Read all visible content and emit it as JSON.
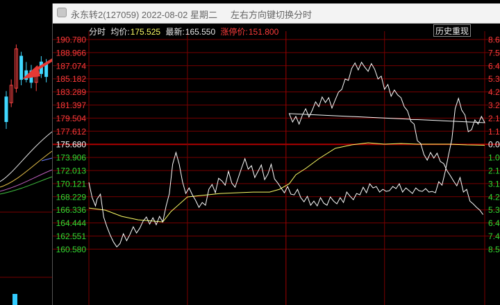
{
  "window": {
    "title": "永东转2(127059) 2022-08-02 星期二",
    "hint": "左右方向键切换分时"
  },
  "infobar": {
    "mode_label": "分时",
    "avg_label": "均价:",
    "avg_value": "175.525",
    "latest_label": "最新:",
    "latest_value": "165.550",
    "limit_label": "涨停价:",
    "limit_value": "151.800"
  },
  "history_button": "历史重现",
  "colors": {
    "up": "#ff3b3b",
    "down": "#33dd33",
    "flat": "#ffffff",
    "grid": "#7a0000",
    "price_line": "#ffffff",
    "avg_line": "#ffff66"
  },
  "chart_data": {
    "type": "line",
    "title": "",
    "reference_price": 175.68,
    "ylim": [
      160.58,
      190.78
    ],
    "y_ticks": [
      "190.780",
      "188.966",
      "187.074",
      "185.182",
      "183.289",
      "181.397",
      "179.504",
      "177.612",
      "175.680",
      "173.906",
      "172.013",
      "170.121",
      "168.229",
      "166.336",
      "164.444",
      "162.551",
      "160.580"
    ],
    "pct_ticks": [
      "8.6",
      "7.5",
      "6.4",
      "5.3",
      "4.2",
      "3.2",
      "2.1",
      "1.1",
      "0.0",
      "1.0",
      "2.1",
      "3.1",
      "4.2",
      "5.3",
      "6.4",
      "7.4",
      "8.5"
    ],
    "series": [
      {
        "role": "price",
        "x": [
          0,
          2,
          4,
          5,
          7,
          9,
          11,
          13,
          15,
          17,
          19,
          21,
          23,
          25,
          27,
          29,
          31,
          33,
          35,
          37,
          39,
          41,
          43,
          45,
          47,
          49,
          51,
          53,
          55,
          57,
          59,
          61,
          63,
          65,
          67,
          69,
          71,
          73,
          75,
          77,
          79,
          81,
          83,
          85,
          87,
          89,
          91,
          93,
          95,
          97,
          99,
          101,
          103,
          105,
          107,
          109,
          111,
          113,
          115,
          117,
          119,
          121,
          123,
          125,
          127,
          129,
          131,
          133,
          135,
          137,
          139,
          141,
          143,
          145,
          147,
          149,
          151,
          153,
          155,
          157,
          159,
          161,
          163,
          165,
          167,
          169,
          171,
          173,
          175,
          177,
          179,
          181,
          183,
          185,
          187,
          189,
          191,
          193,
          195,
          197,
          199,
          201,
          203,
          205,
          207,
          209,
          211,
          213,
          215,
          217,
          219,
          221,
          223,
          225,
          227,
          229,
          231,
          233,
          235,
          237,
          239,
          241
        ],
        "values": [
          170.2,
          168.0,
          166.8,
          167.8,
          168.5,
          165.2,
          163.8,
          162.6,
          161.6,
          160.9,
          161.4,
          162.8,
          161.8,
          162.7,
          163.8,
          162.9,
          163.6,
          164.6,
          165.2,
          164.2,
          165.1,
          164.1,
          165.3,
          164.5,
          166.8,
          168.6,
          172.8,
          174.5,
          172.8,
          170.3,
          168.6,
          169.4,
          168.4,
          167.6,
          166.6,
          167.3,
          166.9,
          169.2,
          169.9,
          168.7,
          170.8,
          170.4,
          169.8,
          171.8,
          170.1,
          169.5,
          170.9,
          172.3,
          173.6,
          172.1,
          172.6,
          170.9,
          171.8,
          172.7,
          170.6,
          171.4,
          172.8,
          170.7,
          170.1,
          169.4,
          168.7,
          169.6,
          168.5,
          168.4,
          169.2,
          168.0,
          167.4,
          168.2,
          166.9,
          167.5,
          166.8,
          168.0,
          167.2,
          166.9,
          168.1,
          167.5,
          167.1,
          168.0,
          167.3,
          168.8,
          168.2,
          167.7,
          168.6,
          168.4,
          169.5,
          168.7,
          170.0,
          169.4,
          169.6,
          168.8,
          169.2,
          168.9,
          169.0,
          169.6,
          169.3,
          170.0,
          168.8,
          169.4,
          169.0,
          168.6,
          169.4,
          169.0,
          168.9,
          169.3,
          168.8,
          168.9,
          168.7,
          170.3,
          169.8,
          171.8,
          174.2,
          176.4,
          180.8,
          182.3,
          180.6,
          179.9,
          177.5,
          177.8,
          179.2,
          178.6,
          179.7,
          178.8
        ],
        "x2": [
          122,
          124,
          126,
          128,
          130,
          132,
          134,
          136,
          138,
          140,
          142,
          144,
          146,
          148,
          150,
          152,
          154,
          156,
          158,
          160,
          162,
          164,
          166,
          168,
          170,
          172,
          174,
          176,
          178,
          180,
          182,
          184,
          186,
          188,
          190,
          192,
          194,
          196,
          198,
          200,
          202,
          204,
          206,
          208,
          210,
          212,
          214,
          216,
          218,
          220,
          222,
          224,
          226,
          228,
          230,
          232,
          234,
          236,
          238,
          240
        ],
        "values2": [
          180.1,
          178.9,
          179.7,
          178.6,
          179.9,
          180.8,
          179.6,
          180.6,
          181.8,
          181.1,
          182.5,
          181.7,
          182.4,
          180.9,
          182.1,
          183.2,
          183.6,
          185.1,
          184.9,
          186.6,
          187.4,
          186.4,
          187.5,
          186.8,
          186.2,
          187.3,
          186.5,
          185.1,
          185.5,
          183.6,
          184.3,
          182.6,
          183.5,
          182.8,
          182.4,
          181.1,
          180.5,
          179.0,
          178.6,
          176.2,
          175.8,
          174.2,
          173.4,
          174.5,
          173.7,
          174.4,
          173.2,
          172.9,
          171.9,
          171.2,
          170.4,
          169.7,
          170.9,
          168.8,
          169.2,
          167.5,
          167.1,
          166.6,
          166.2,
          165.55
        ]
      }
    ],
    "avg_line": {
      "x": [
        0,
        10,
        20,
        30,
        45,
        50,
        60,
        80,
        100,
        110,
        116,
        122,
        126,
        132,
        140,
        150,
        160,
        170,
        180,
        190,
        200,
        210,
        220,
        230,
        241
      ],
      "values": [
        166.5,
        166.2,
        165.3,
        164.8,
        164.5,
        166.0,
        168.1,
        168.6,
        168.8,
        168.8,
        169.2,
        170.0,
        171.3,
        172.2,
        173.6,
        175.1,
        175.6,
        175.9,
        175.7,
        175.8,
        175.7,
        175.7,
        175.7,
        175.6,
        175.55
      ]
    }
  },
  "background_chart": {
    "candles": [
      {
        "o": 0.45,
        "c": 0.62,
        "h": 0.66,
        "l": 0.4,
        "up": false
      },
      {
        "o": 0.58,
        "c": 0.7,
        "h": 0.74,
        "l": 0.55,
        "up": true
      },
      {
        "o": 0.68,
        "c": 0.95,
        "h": 0.98,
        "l": 0.65,
        "up": true
      },
      {
        "o": 0.9,
        "c": 0.74,
        "h": 0.93,
        "l": 0.7,
        "up": false
      },
      {
        "o": 0.74,
        "c": 0.8,
        "h": 0.86,
        "l": 0.72,
        "up": false
      },
      {
        "o": 0.8,
        "c": 0.72,
        "h": 0.84,
        "l": 0.68,
        "up": false
      },
      {
        "o": 0.72,
        "c": 0.78,
        "h": 0.83,
        "l": 0.66,
        "up": true
      },
      {
        "o": 0.78,
        "c": 0.86,
        "h": 0.9,
        "l": 0.75,
        "up": false
      },
      {
        "o": 0.85,
        "c": 0.76,
        "h": 0.88,
        "l": 0.72,
        "up": false
      }
    ]
  }
}
